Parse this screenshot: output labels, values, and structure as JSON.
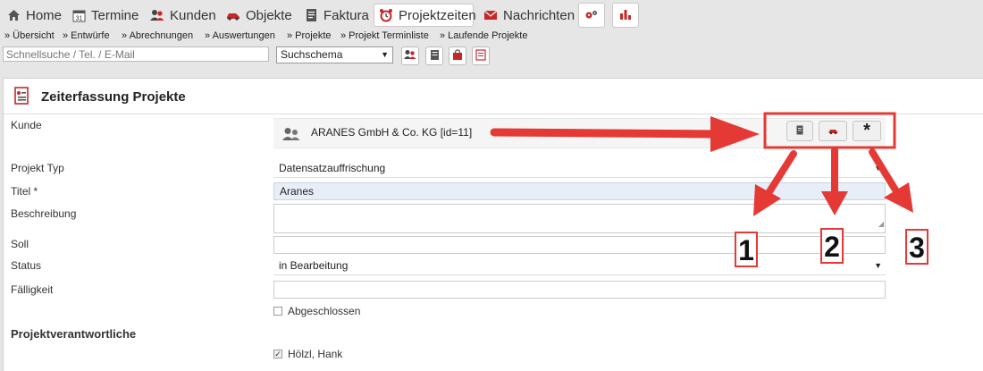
{
  "topnav": {
    "items": [
      {
        "label": "Home",
        "icon": "home-icon"
      },
      {
        "label": "Termine",
        "icon": "calendar-icon"
      },
      {
        "label": "Kunden",
        "icon": "users-icon"
      },
      {
        "label": "Objekte",
        "icon": "car-icon"
      },
      {
        "label": "Faktura",
        "icon": "document-icon"
      },
      {
        "label": "Projektzeiten",
        "icon": "alarm-clock-icon",
        "active": true
      },
      {
        "label": "Nachrichten",
        "icon": "envelope-icon"
      }
    ],
    "extra_buttons": [
      "gears-icon",
      "bar-chart-icon"
    ]
  },
  "subnav": {
    "items": [
      "» Übersicht",
      "» Entwürfe",
      "» Abrechnungen",
      "» Auswertungen",
      "» Projekte",
      "» Projekt Terminliste",
      "» Laufende Projekte"
    ]
  },
  "toolbar": {
    "search_placeholder": "Schnellsuche / Tel. / E-Mail",
    "schema_value": "Suchschema"
  },
  "page": {
    "title": "Zeiterfassung Projekte"
  },
  "form": {
    "kunde_label": "Kunde",
    "kunde_value": "ARANES GmbH & Co. KG [id=11]",
    "projekt_typ_label": "Projekt Typ",
    "projekt_typ_value": "Datensatzauffrischung",
    "titel_label": "Titel *",
    "titel_value": "Aranes",
    "beschreibung_label": "Beschreibung",
    "soll_label": "Soll",
    "status_label": "Status",
    "status_value": "in Bearbeitung",
    "faelligkeit_label": "Fälligkeit",
    "abgeschlossen_label": "Abgeschlossen",
    "abgeschlossen_checked": false,
    "verantwortliche_heading": "Projektverantwortliche",
    "verantwortlicher_name": "Hölzl, Hank",
    "verantwortlicher_checked": true
  },
  "annotations": {
    "labels": [
      "1",
      "2",
      "3"
    ],
    "color": "#e53935"
  },
  "colors": {
    "accent_red": "#c62828",
    "title_input_bg": "#e8eef8",
    "annotation_red": "#e53935"
  }
}
